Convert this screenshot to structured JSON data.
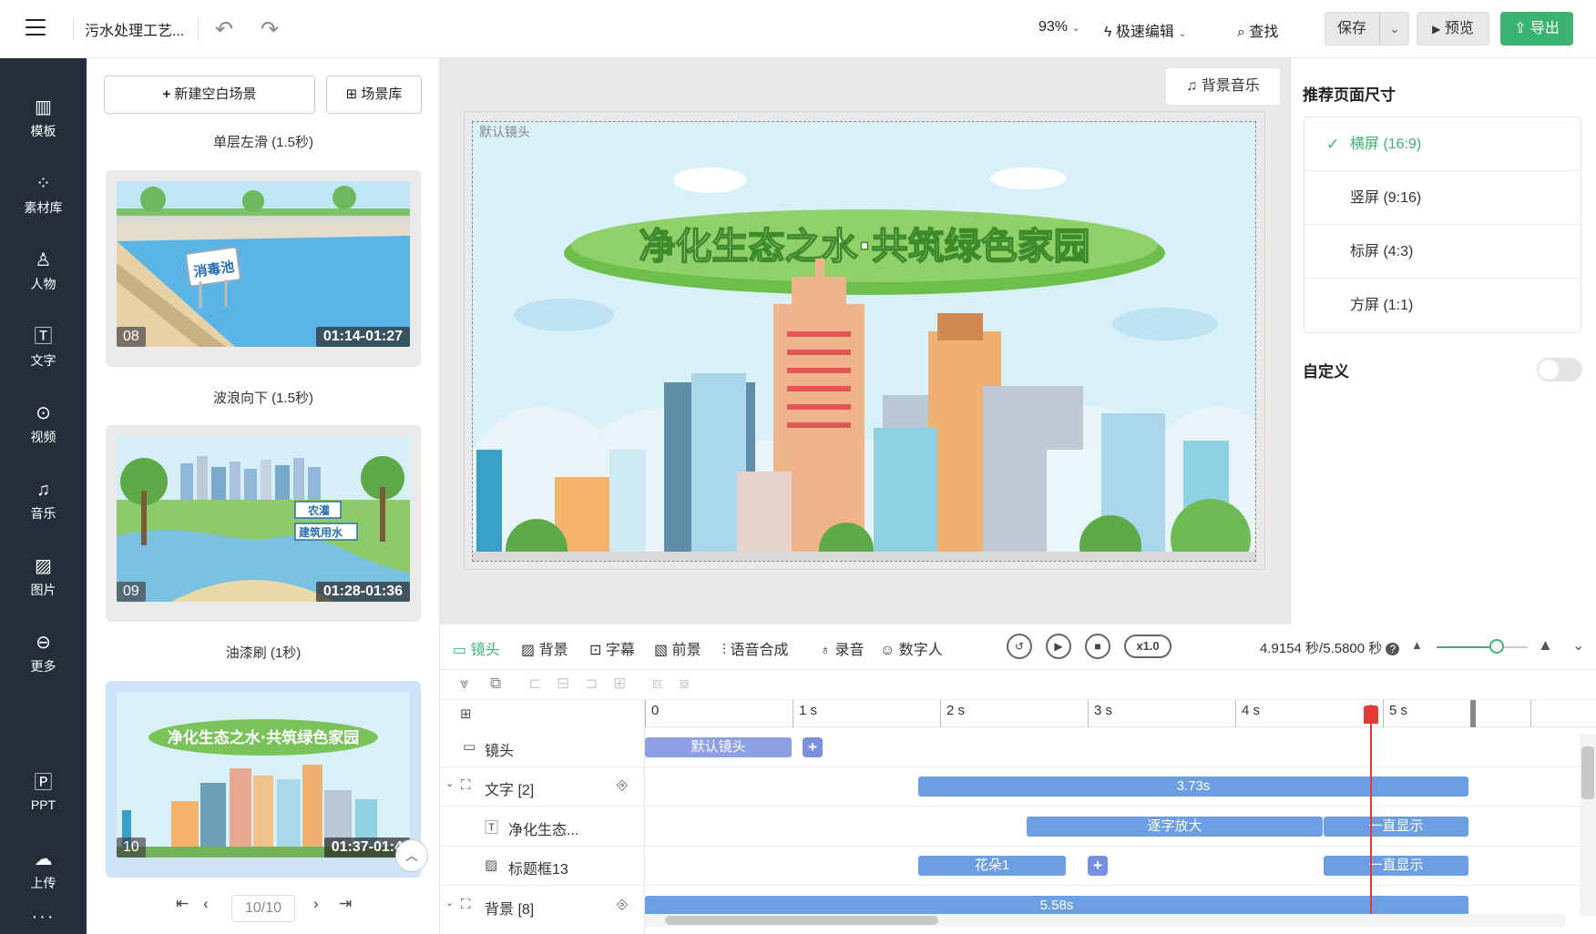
{
  "topbar": {
    "title": "污水处理工艺...",
    "zoom": "93%",
    "edit_mode": "极速编辑",
    "find": "查找",
    "save": "保存",
    "preview": "预览",
    "export": "导出"
  },
  "nav": [
    {
      "label": "模板",
      "icon": "template-icon"
    },
    {
      "label": "素材库",
      "icon": "material-icon"
    },
    {
      "label": "人物",
      "icon": "person-icon"
    },
    {
      "label": "文字",
      "icon": "text-icon"
    },
    {
      "label": "视频",
      "icon": "video-icon"
    },
    {
      "label": "音乐",
      "icon": "music-icon"
    },
    {
      "label": "图片",
      "icon": "image-icon"
    },
    {
      "label": "更多",
      "icon": "more-icon"
    },
    {
      "label": "PPT",
      "icon": "ppt-icon"
    },
    {
      "label": "上传",
      "icon": "upload-icon"
    }
  ],
  "scene_panel": {
    "new_scene": "新建空白场景",
    "scene_library": "场景库",
    "scenes": [
      {
        "transition": "单层左滑 (1.5秒)",
        "num": "08",
        "time": "01:14-01:27",
        "sign": "消毒池"
      },
      {
        "transition": "波浪向下 (1.5秒)",
        "num": "09",
        "time": "01:28-01:36",
        "sign1": "农灌",
        "sign2": "建筑用水"
      },
      {
        "transition": "油漆刷 (1秒)",
        "num": "10",
        "time": "01:37-01:4",
        "banner": "净化生态之水·共筑绿色家园"
      }
    ],
    "page": "10/10"
  },
  "canvas": {
    "bgm": "背景音乐",
    "shot_label": "默认镜头",
    "banner": "净化生态之水·共筑绿色家园"
  },
  "right_panel": {
    "title": "推荐页面尺寸",
    "options": [
      "横屏 (16:9)",
      "竖屏 (9:16)",
      "标屏 (4:3)",
      "方屏 (1:1)"
    ],
    "selected": "横屏 (16:9)",
    "custom": "自定义",
    "custom_enabled": false
  },
  "timeline": {
    "tabs": [
      "镜头",
      "背景",
      "字幕",
      "前景",
      "语音合成",
      "录音",
      "数字人"
    ],
    "speed": "x1.0",
    "time": "4.9154 秒/5.5800 秒",
    "ticks": [
      "0",
      "1 s",
      "2 s",
      "3 s",
      "4 s",
      "5 s"
    ],
    "tracks": [
      {
        "label": "镜头",
        "clips": [
          "默认镜头"
        ]
      },
      {
        "label": "文字 [2]",
        "clips": [
          "3.73s"
        ]
      },
      {
        "label": "净化生态...",
        "clips": [
          "逐字放大",
          "一直显示"
        ]
      },
      {
        "label": "标题框13",
        "clips": [
          "花朵1",
          "一直显示"
        ]
      },
      {
        "label": "背景 [8]",
        "clips": [
          "5.58s"
        ]
      }
    ]
  },
  "colors": {
    "accent": "#3cb371",
    "nav_bg": "#232e3a",
    "clip_blue": "#6b9ee3",
    "clip_purple": "#8f9fe6",
    "playhead": "#e53935"
  }
}
